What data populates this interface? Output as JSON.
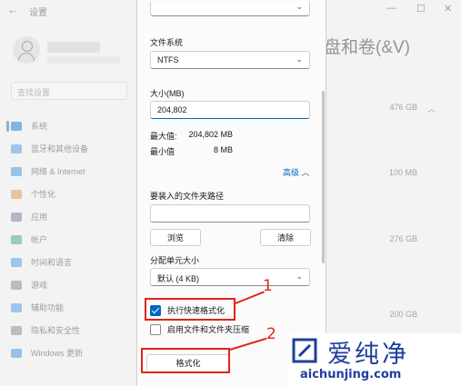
{
  "settings": {
    "title": "设置",
    "back_glyph": "←",
    "window_controls": {
      "minimize": "—",
      "maximize": "☐",
      "close": "✕"
    },
    "search_placeholder": "查找设置",
    "page_heading": "盘和卷(&V)",
    "nav": [
      {
        "label": "系统",
        "color": "#0067c0"
      },
      {
        "label": "蓝牙和其他设备",
        "color": "#3a8ee6"
      },
      {
        "label": "网络 & Internet",
        "color": "#2b88d8"
      },
      {
        "label": "个性化",
        "color": "#e08a3c"
      },
      {
        "label": "应用",
        "color": "#6b6b8a"
      },
      {
        "label": "帐户",
        "color": "#2aa36b"
      },
      {
        "label": "时间和语言",
        "color": "#3a8ee6"
      },
      {
        "label": "游戏",
        "color": "#7a7a7a"
      },
      {
        "label": "辅助功能",
        "color": "#3a8ee6"
      },
      {
        "label": "隐私和安全性",
        "color": "#7a7a7a"
      },
      {
        "label": "Windows 更新",
        "color": "#2b88d8"
      }
    ],
    "sizes": [
      "476 GB",
      "100 MB",
      "276 GB",
      "200 GB"
    ]
  },
  "dialog": {
    "filesystem_label": "文件系统",
    "filesystem_value": "NTFS",
    "size_label": "大小(MB)",
    "size_value": "204,802",
    "max_label": "最大值:",
    "max_value": "204,802 MB",
    "min_label": "最小值",
    "min_value": "8 MB",
    "advanced_label": "高级",
    "mount_label": "要装入的文件夹路径",
    "mount_value": "",
    "browse_button": "浏览",
    "clear_button": "清除",
    "cluster_label": "分配单元大小",
    "cluster_value": "默认 (4 KB)",
    "quick_format_label": "执行快速格式化",
    "quick_format_checked": true,
    "compression_label": "启用文件和文件夹压缩",
    "compression_checked": false,
    "format_button": "格式化"
  },
  "annotations": {
    "step1": "1",
    "step2": "2",
    "color": "#e2231a"
  },
  "watermark": {
    "cn": "爱纯净",
    "en": "aichunjing.com"
  }
}
